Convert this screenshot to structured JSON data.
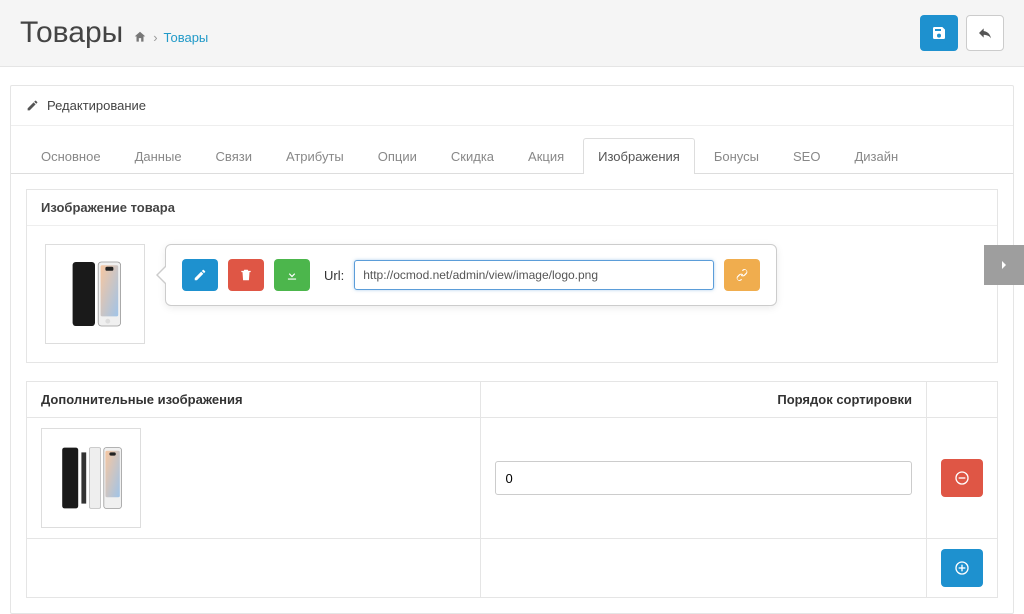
{
  "header": {
    "title": "Товары",
    "breadcrumb_link": "Товары"
  },
  "panel": {
    "heading": "Редактирование"
  },
  "tabs": [
    {
      "id": "general",
      "label": "Основное"
    },
    {
      "id": "data",
      "label": "Данные"
    },
    {
      "id": "links",
      "label": "Связи"
    },
    {
      "id": "attribute",
      "label": "Атрибуты"
    },
    {
      "id": "option",
      "label": "Опции"
    },
    {
      "id": "discount",
      "label": "Скидка"
    },
    {
      "id": "special",
      "label": "Акция"
    },
    {
      "id": "image",
      "label": "Изображения",
      "active": true
    },
    {
      "id": "reward",
      "label": "Бонусы"
    },
    {
      "id": "seo",
      "label": "SEO"
    },
    {
      "id": "design",
      "label": "Дизайн"
    }
  ],
  "image_section": {
    "heading": "Изображение товара",
    "popover": {
      "url_label": "Url:",
      "url_value": "http://ocmod.net/admin/view/image/logo.png"
    }
  },
  "additional_images": {
    "col_images": "Дополнительные изображения",
    "col_sort": "Порядок сортировки",
    "rows": [
      {
        "sort_order": "0"
      }
    ]
  },
  "colors": {
    "primary": "#1e91cf",
    "danger": "#df5645",
    "success": "#4cb64c",
    "warning": "#f0ad4e"
  }
}
